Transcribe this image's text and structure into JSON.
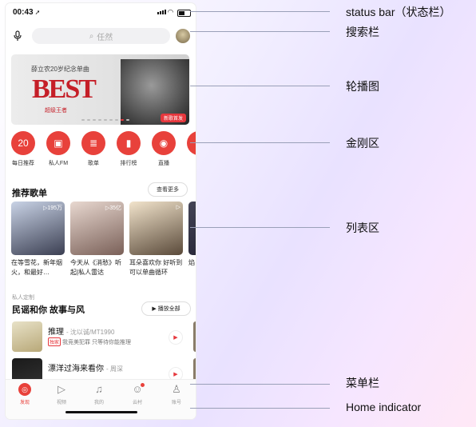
{
  "status_bar": {
    "time": "00:43"
  },
  "search": {
    "placeholder": "任然"
  },
  "banner": {
    "subtitle": "薛立农20岁纪念单曲",
    "big_text": "BEST",
    "album_text": "超级王者",
    "tag": "新歌首发"
  },
  "quick_actions": [
    {
      "label": "每日推荐",
      "icon": "calendar-icon",
      "glyph": "20"
    },
    {
      "label": "私人FM",
      "icon": "radio-icon",
      "glyph": "▣"
    },
    {
      "label": "歌单",
      "icon": "playlist-icon",
      "glyph": "≣"
    },
    {
      "label": "排行榜",
      "icon": "chart-icon",
      "glyph": "▮"
    },
    {
      "label": "直播",
      "icon": "live-icon",
      "glyph": "◉"
    },
    {
      "label": "",
      "icon": "partial-icon",
      "glyph": "◔"
    }
  ],
  "recommend": {
    "title": "推荐歌单",
    "more": "查看更多",
    "cards": [
      {
        "title": "在等雪花，新年烟火，和最好…",
        "plays": "▷195万",
        "color_a": "#c9d3e6",
        "color_b": "#3b3f52"
      },
      {
        "title": "今天从《消愁》听起|私人雷达",
        "plays": "▷35亿",
        "color_a": "#e8d8d0",
        "color_b": "#7a6058"
      },
      {
        "title": "耳朵喜欢你 好听到可以单曲循环",
        "plays": "▷",
        "color_a": "#f2e4cc",
        "color_b": "#5a4a3a"
      },
      {
        "title": "焰",
        "plays": "",
        "color_a": "#445",
        "color_b": "#223"
      }
    ]
  },
  "private": {
    "label": "私人定制",
    "title": "民谣和你 故事与风",
    "play_all": "▶ 播放全部",
    "songs": [
      {
        "name": "推理",
        "artist": "- 沈以诚/MT1990",
        "badge": "独家",
        "desc": "我竞美犯罪 只等待你能推理",
        "thumb_a": "#e8e2c8",
        "thumb_b": "#b8a878"
      },
      {
        "name": "漂洋过海来看你",
        "artist": "- 周深",
        "badge": "",
        "desc": "",
        "thumb_a": "#1a1a1a",
        "thumb_b": "#333"
      }
    ]
  },
  "tabbar": [
    {
      "label": "发现",
      "icon": "discover-icon",
      "glyph": "◎",
      "active": true
    },
    {
      "label": "视频",
      "icon": "video-icon",
      "glyph": "▷",
      "active": false
    },
    {
      "label": "我的",
      "icon": "music-icon",
      "glyph": "♫",
      "active": false
    },
    {
      "label": "云村",
      "icon": "community-icon",
      "glyph": "☺",
      "active": false
    },
    {
      "label": "账号",
      "icon": "account-icon",
      "glyph": "♙",
      "active": false
    }
  ],
  "callouts": [
    "status bar（状态栏）",
    "搜索栏",
    "轮播图",
    "金刚区",
    "列表区",
    "菜单栏",
    "Home indicator"
  ],
  "colors": {
    "accent": "#e8413b",
    "line": "#9aa0b8"
  }
}
